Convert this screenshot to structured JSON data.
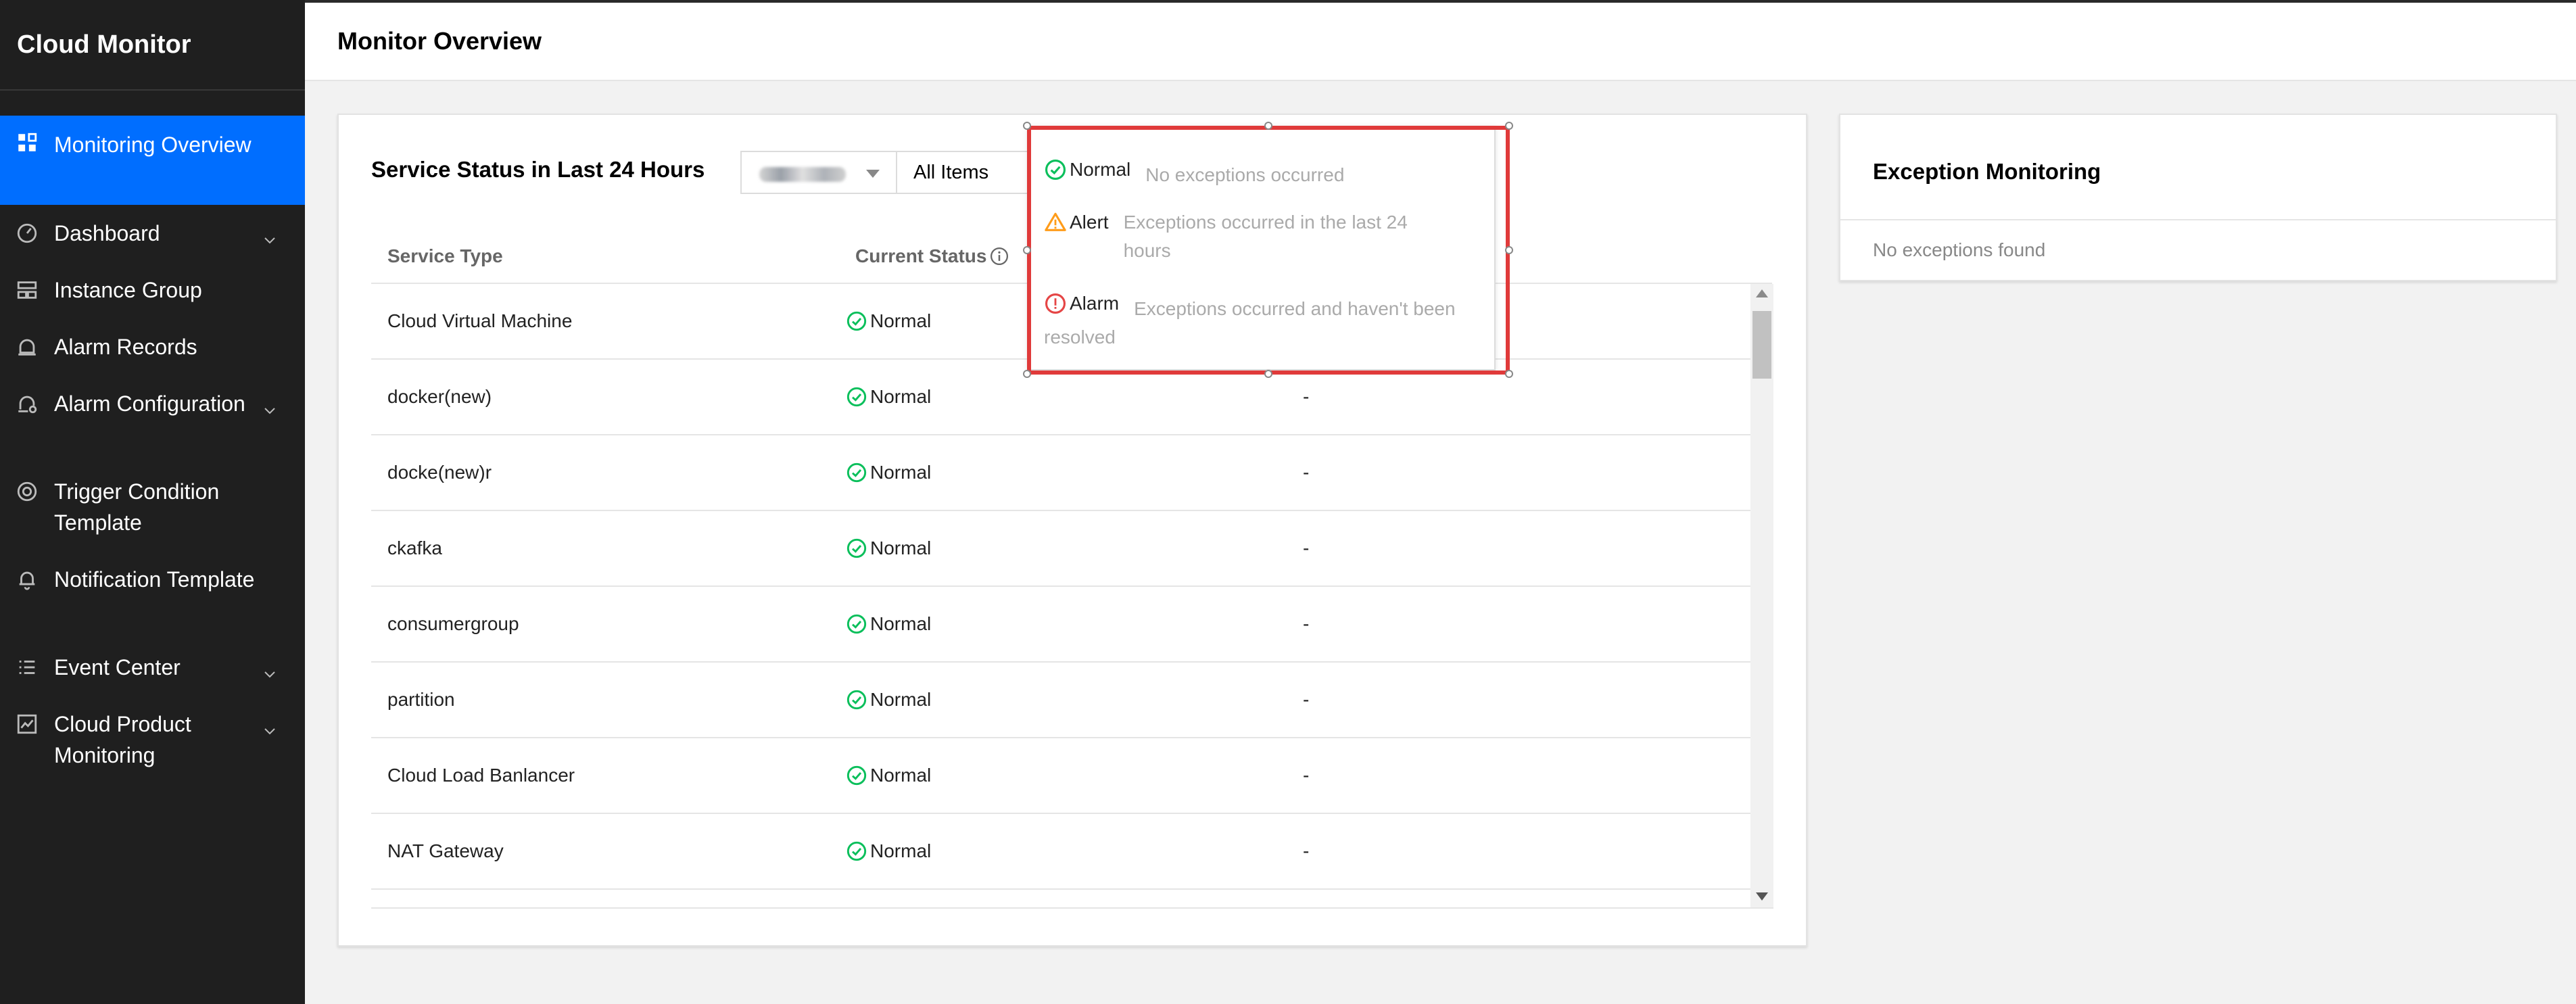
{
  "app": {
    "title": "Cloud Monitor"
  },
  "header": {
    "title": "Monitor Overview"
  },
  "sidebar": {
    "items": [
      {
        "label": "Monitoring Overview",
        "icon": "grid-icon",
        "active": true,
        "expandable": false
      },
      {
        "label": "Dashboard",
        "icon": "gauge-icon",
        "active": false,
        "expandable": true
      },
      {
        "label": "Instance Group",
        "icon": "layers-icon",
        "active": false,
        "expandable": false
      },
      {
        "label": "Alarm Records",
        "icon": "alarm-icon",
        "active": false,
        "expandable": false
      },
      {
        "label": "Alarm Configuration",
        "icon": "alarm-config-icon",
        "active": false,
        "expandable": true
      },
      {
        "label": "Trigger Condition Template",
        "icon": "target-icon",
        "active": false,
        "expandable": false
      },
      {
        "label": "Notification Template",
        "icon": "bell-icon",
        "active": false,
        "expandable": false
      },
      {
        "label": "Event Center",
        "icon": "list-icon",
        "active": false,
        "expandable": true
      },
      {
        "label": "Cloud Product Monitoring",
        "icon": "chart-icon",
        "active": false,
        "expandable": true
      }
    ]
  },
  "service_status": {
    "title": "Service Status in Last 24 Hours",
    "items_filter": "All Items",
    "columns": {
      "service_type": "Service Type",
      "current_status": "Current Status"
    },
    "rows": [
      {
        "type": "Cloud Virtual Machine",
        "status": "Normal",
        "extra": "-"
      },
      {
        "type": "docker(new)",
        "status": "Normal",
        "extra": "-"
      },
      {
        "type": "docke(new)r",
        "status": "Normal",
        "extra": "-"
      },
      {
        "type": "ckafka",
        "status": "Normal",
        "extra": "-"
      },
      {
        "type": "consumergroup",
        "status": "Normal",
        "extra": "-"
      },
      {
        "type": "partition",
        "status": "Normal",
        "extra": "-"
      },
      {
        "type": "Cloud Load Banlancer",
        "status": "Normal",
        "extra": "-"
      },
      {
        "type": "NAT Gateway",
        "status": "Normal",
        "extra": "-"
      }
    ]
  },
  "status_legend": {
    "normal": {
      "label": "Normal",
      "desc": "No exceptions occurred"
    },
    "alert": {
      "label": "Alert",
      "desc": "Exceptions occurred in the last 24 hours"
    },
    "alarm": {
      "label": "Alarm",
      "desc": "Exceptions occurred and haven't been resolved"
    }
  },
  "exception_monitoring": {
    "title": "Exception Monitoring",
    "empty": "No exceptions found"
  },
  "colors": {
    "sidebar_bg": "#1f1f1f",
    "active_blue": "#006eff",
    "normal_green": "#0abf5b",
    "alert_orange": "#ff9c19",
    "alarm_red": "#e54545",
    "highlight_red": "#e03a3a"
  }
}
